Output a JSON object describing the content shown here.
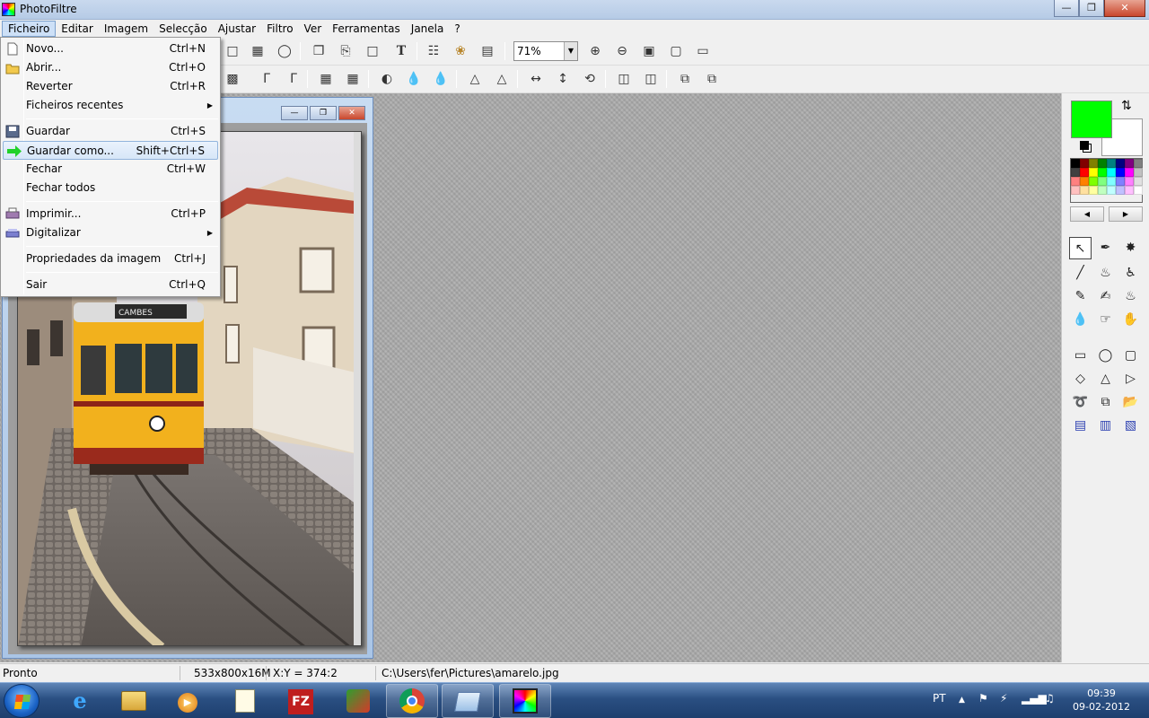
{
  "window": {
    "title": "PhotoFiltre"
  },
  "menubar": [
    "Ficheiro",
    "Editar",
    "Imagem",
    "Selecção",
    "Ajustar",
    "Filtro",
    "Ver",
    "Ferramentas",
    "Janela",
    "?"
  ],
  "zoom": {
    "value": "71%"
  },
  "file_menu": {
    "items": [
      {
        "label": "Novo...",
        "shortcut": "Ctrl+N"
      },
      {
        "label": "Abrir...",
        "shortcut": "Ctrl+O"
      },
      {
        "label": "Reverter",
        "shortcut": "Ctrl+R"
      },
      {
        "label": "Ficheiros recentes",
        "shortcut": ""
      },
      {
        "label": "Guardar",
        "shortcut": "Ctrl+S"
      },
      {
        "label": "Guardar como...",
        "shortcut": "Shift+Ctrl+S"
      },
      {
        "label": "Fechar",
        "shortcut": "Ctrl+W"
      },
      {
        "label": "Fechar todos",
        "shortcut": ""
      },
      {
        "label": "Imprimir...",
        "shortcut": "Ctrl+P"
      },
      {
        "label": "Digitalizar",
        "shortcut": ""
      },
      {
        "label": "Propriedades da imagem",
        "shortcut": "Ctrl+J"
      },
      {
        "label": "Sair",
        "shortcut": "Ctrl+Q"
      }
    ],
    "highlighted": "Guardar como..."
  },
  "colors": {
    "foreground": "#00ff00",
    "background": "#ffffff"
  },
  "status": {
    "state": "Pronto",
    "dimensions": "533x800x16M",
    "coords": "X:Y = 374:2",
    "path": "C:\\Users\\fer\\Pictures\\amarelo.jpg"
  },
  "taskbar": {
    "language": "PT",
    "time": "09:39",
    "date": "09-02-2012",
    "filezilla_label": "FZ"
  },
  "image": {
    "tram_sign": "CAMBES"
  }
}
